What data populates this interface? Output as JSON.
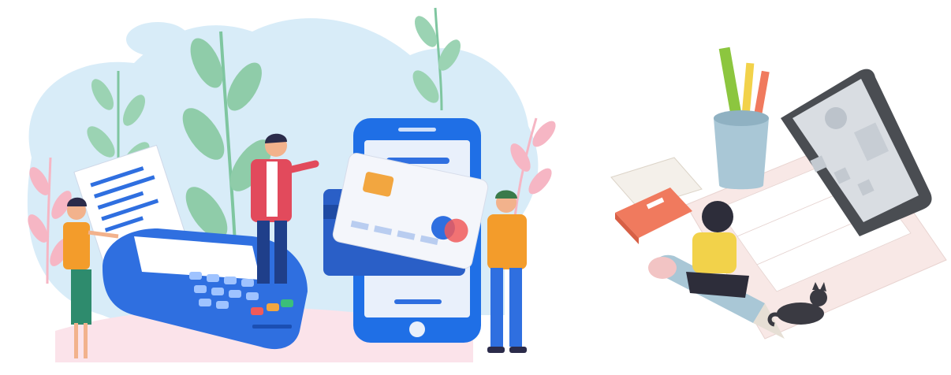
{
  "image": {
    "panels": [
      {
        "id": "payment-illustration",
        "subject": "card-terminal-and-phone-payment"
      },
      {
        "id": "workspace-illustration",
        "subject": "laptop-with-stationery"
      }
    ]
  },
  "colors": {
    "blob": "#d8ecf8",
    "leaf": "#7fc6a0",
    "leaf_pink": "#f6b6c4",
    "terminal_blue": "#2f6fe0",
    "phone_blue": "#1f6fe6",
    "card_white": "#f4f6fb",
    "card_chip": "#f2a640",
    "shirt_orange": "#f39c2b",
    "jacket_red": "#e24a5c",
    "laptop_gray": "#4a4d52",
    "keyboard_pink": "#f8e8e6",
    "book_coral": "#f07a5e",
    "pencil_yellow": "#f2d24a",
    "ruler_green": "#8cc63f"
  },
  "icons": [
    "card-terminal-icon",
    "smartphone-icon",
    "credit-card-icon",
    "receipt-icon",
    "laptop-icon",
    "pencil-cup-icon",
    "book-icon",
    "cat-icon"
  ]
}
